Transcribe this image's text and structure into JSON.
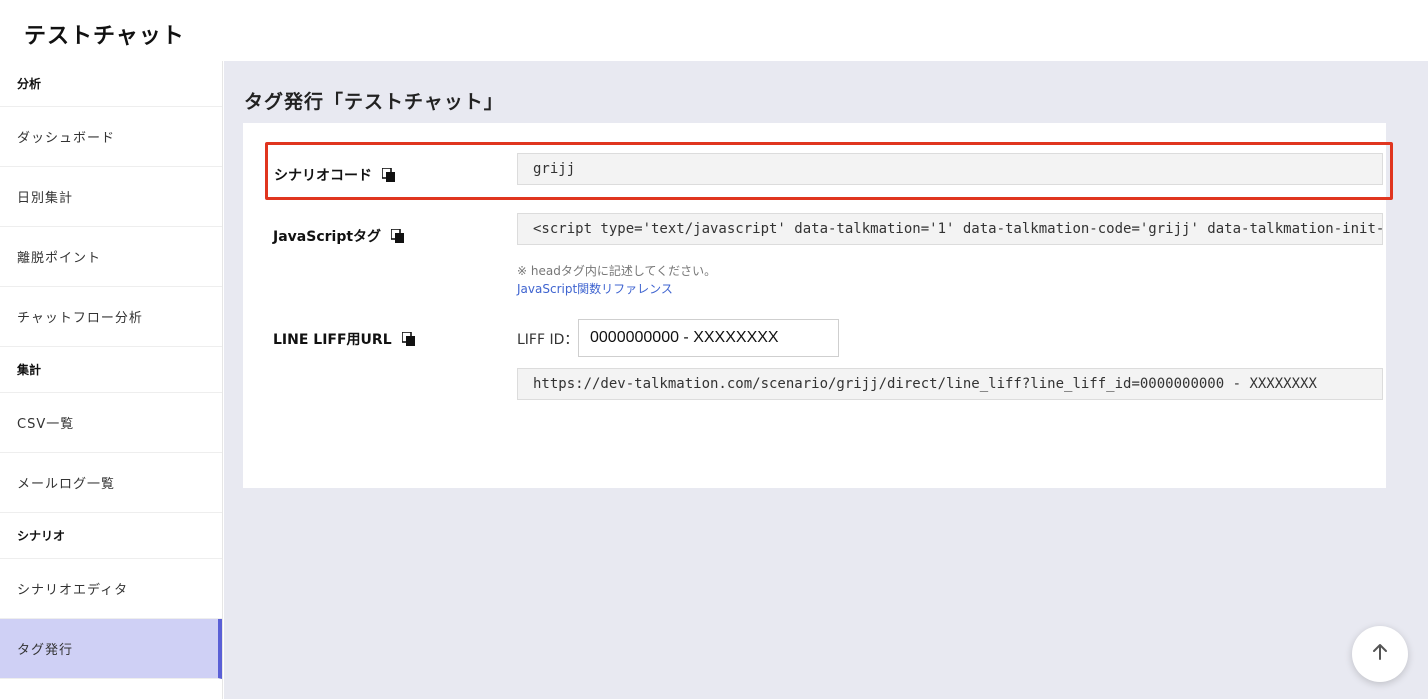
{
  "app": {
    "title": "テストチャット"
  },
  "sidebar": {
    "groups": [
      {
        "heading": "分析",
        "items": [
          "ダッシュボード",
          "日別集計",
          "離脱ポイント",
          "チャットフロー分析"
        ]
      },
      {
        "heading": "集計",
        "items": [
          "CSV一覧",
          "メールログ一覧"
        ]
      },
      {
        "heading": "シナリオ",
        "items": [
          "シナリオエディタ",
          "タグ発行"
        ]
      }
    ],
    "active_item": "タグ発行"
  },
  "page": {
    "title": "タグ発行「テストチャット」"
  },
  "fields": {
    "scenario_code": {
      "label": "シナリオコード",
      "value": "grijj"
    },
    "javascript_tag": {
      "label": "JavaScriptタグ",
      "value": "<script type='text/javascript' data-talkmation='1' data-talkmation-code='grijj' data-talkmation-init-",
      "note": "※ headタグ内に記述してください。",
      "link": "JavaScript関数リファレンス"
    },
    "line_liff_url": {
      "label": "LINE LIFF用URL",
      "liff_id_label": "LIFF ID：",
      "liff_id_value": "0000000000 - XXXXXXXX",
      "url": "https://dev-talkmation.com/scenario/grijj/direct/line_liff?line_liff_id=0000000000 - XXXXXXXX"
    }
  },
  "colors": {
    "accent": "#5a5fd6",
    "active_bg": "#cfd0f5",
    "highlight_border": "#e0351f",
    "link": "#3f64d0",
    "main_bg": "#e8e9f1"
  },
  "icons": {
    "copy": "copy-icon",
    "scroll_top": "arrow-up-icon"
  }
}
